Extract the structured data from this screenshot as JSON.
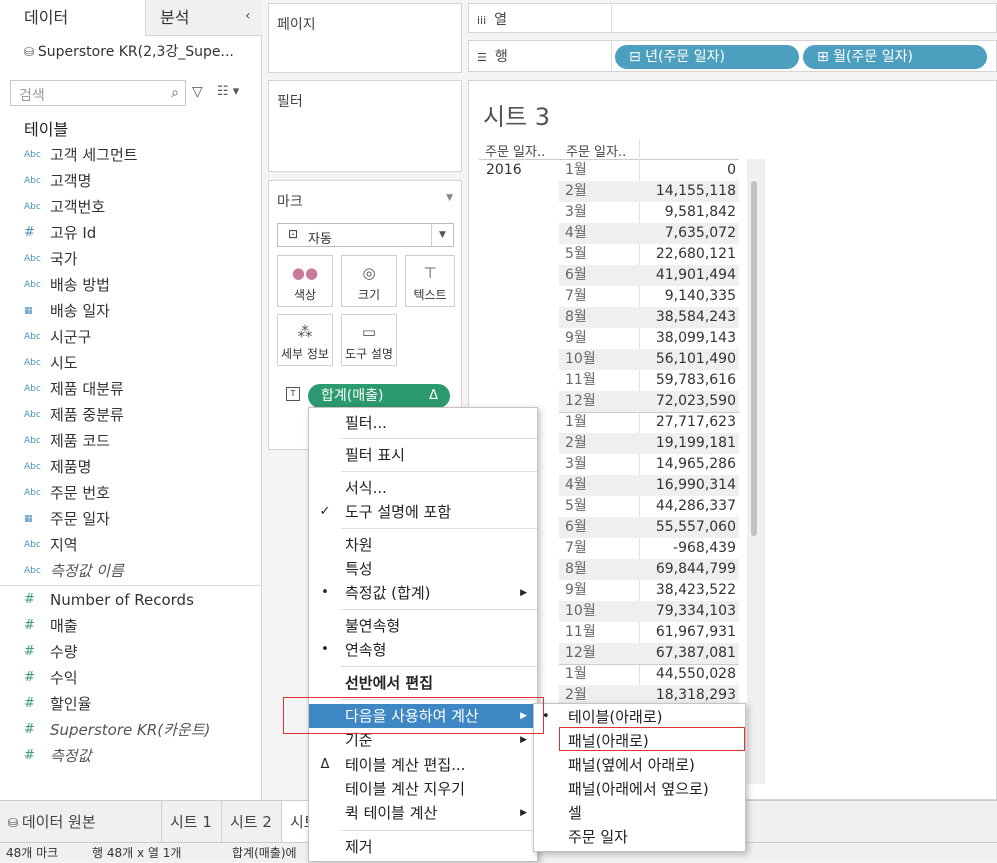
{
  "left_pane": {
    "tab_data": "데이터",
    "tab_analysis": "분석",
    "collapse": "‹",
    "datasource": "Superstore KR(2,3강_Supe...",
    "search_placeholder": "검색",
    "tables_heading": "테이블",
    "dimensions": [
      {
        "type": "Abc",
        "name": "고객 세그먼트"
      },
      {
        "type": "Abc",
        "name": "고객명"
      },
      {
        "type": "Abc",
        "name": "고객번호"
      },
      {
        "type": "#",
        "name": "고유 Id"
      },
      {
        "type": "Abc",
        "name": "국가"
      },
      {
        "type": "Abc",
        "name": "배송 방법"
      },
      {
        "type": "date",
        "name": "배송 일자"
      },
      {
        "type": "Abc",
        "name": "시군구"
      },
      {
        "type": "Abc",
        "name": "시도"
      },
      {
        "type": "Abc",
        "name": "제품 대분류"
      },
      {
        "type": "Abc",
        "name": "제품 중분류"
      },
      {
        "type": "Abc",
        "name": "제품 코드"
      },
      {
        "type": "Abc",
        "name": "제품명"
      },
      {
        "type": "Abc",
        "name": "주문 번호"
      },
      {
        "type": "date",
        "name": "주문 일자"
      },
      {
        "type": "Abc",
        "name": "지역"
      },
      {
        "type": "Abc",
        "name": "측정값 이름",
        "italic": true
      }
    ],
    "measures": [
      {
        "name": "Number of Records"
      },
      {
        "name": "매출"
      },
      {
        "name": "수량"
      },
      {
        "name": "수익"
      },
      {
        "name": "할인율"
      },
      {
        "name": "Superstore KR(카운트)",
        "italic": true
      },
      {
        "name": "측정값",
        "italic": true
      }
    ]
  },
  "shelves": {
    "pages": "페이지",
    "filters": "필터",
    "marks": "마크",
    "mark_type": "자동",
    "mark_buttons": [
      "색상",
      "크기",
      "텍스트",
      "세부 정보",
      "도구 설명"
    ],
    "mark_pill": "합계(매출)",
    "delta": "Δ",
    "columns_label": "열",
    "rows_label": "행",
    "row_pills": [
      "⊟ 년(주문 일자)",
      "⊞ 월(주문 일자)"
    ]
  },
  "sheet": {
    "title": "시트 3",
    "header_year": "주문 일자..",
    "header_month": "주문 일자..",
    "year_2016": "2016",
    "rows": [
      [
        "1월",
        "0"
      ],
      [
        "2월",
        "14,155,118"
      ],
      [
        "3월",
        "9,581,842"
      ],
      [
        "4월",
        "7,635,072"
      ],
      [
        "5월",
        "22,680,121"
      ],
      [
        "6월",
        "41,901,494"
      ],
      [
        "7월",
        "9,140,335"
      ],
      [
        "8월",
        "38,584,243"
      ],
      [
        "9월",
        "38,099,143"
      ],
      [
        "10월",
        "56,101,490"
      ],
      [
        "11월",
        "59,783,616"
      ],
      [
        "12월",
        "72,023,590"
      ],
      [
        "1월",
        "27,717,623"
      ],
      [
        "2월",
        "19,199,181"
      ],
      [
        "3월",
        "14,965,286"
      ],
      [
        "4월",
        "16,990,314"
      ],
      [
        "5월",
        "44,286,337"
      ],
      [
        "6월",
        "55,557,060"
      ],
      [
        "7월",
        "-968,439"
      ],
      [
        "8월",
        "69,844,799"
      ],
      [
        "9월",
        "38,423,522"
      ],
      [
        "10월",
        "79,334,103"
      ],
      [
        "11월",
        "61,967,931"
      ],
      [
        "12월",
        "67,387,081"
      ],
      [
        "1월",
        "44,550,028"
      ],
      [
        "2월",
        "18,318,293"
      ]
    ]
  },
  "bottom_tabs": [
    "데이터 원본",
    "시트 1",
    "시트 2",
    "시트 3"
  ],
  "status": {
    "marks": "48개 마크",
    "rows_cols": "행 48개  x  열 1개",
    "sum": "합계(매출)에"
  },
  "context_menu": {
    "items": [
      {
        "label": "필터..."
      },
      {
        "label": "필터 표시"
      },
      {
        "label": "서식..."
      },
      {
        "label": "도구 설명에 포함",
        "check": "✓"
      },
      {
        "label": "차원"
      },
      {
        "label": "특성"
      },
      {
        "label": "측정값 (합계)",
        "check": "•",
        "sub": true
      },
      {
        "label": "불연속형"
      },
      {
        "label": "연속형",
        "check": "•"
      },
      {
        "label": "선반에서 편집",
        "bold": true
      },
      {
        "label": "다음을 사용하여 계산",
        "sub": true,
        "highlight": true
      },
      {
        "label": "기준",
        "sub": true
      },
      {
        "label": "테이블 계산 편집...",
        "check": "Δ"
      },
      {
        "label": "테이블 계산 지우기"
      },
      {
        "label": "퀵 테이블 계산",
        "sub": true
      },
      {
        "label": "제거"
      }
    ]
  },
  "submenu": {
    "items": [
      {
        "label": "테이블(아래로)",
        "check": "•"
      },
      {
        "label": "패널(아래로)"
      },
      {
        "label": "패널(옆에서 아래로)"
      },
      {
        "label": "패널(아래에서 옆으로)"
      },
      {
        "label": "셀"
      },
      {
        "label": "주문 일자"
      }
    ]
  }
}
